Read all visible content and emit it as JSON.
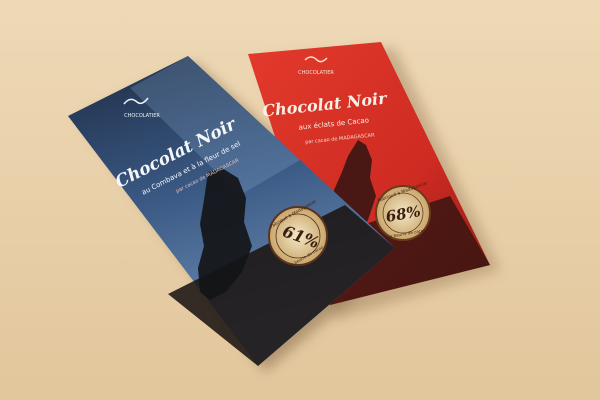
{
  "scene": {
    "background_color": "#e8cfa6",
    "shadow_color": "#a98d6a"
  },
  "bar_red": {
    "color": "#d93228",
    "brand": "CHOCOLATIER",
    "title": "Chocolat Noir",
    "subtitle": "aux éclats de Cacao",
    "origin": "par cacao de MADAGASCAR",
    "seal_top": "Fabriqué à Madagascar",
    "seal_percent": "68%",
    "seal_bottom": "pur beurre de cacao"
  },
  "bar_blue": {
    "color": "#2c4367",
    "brand": "CHOCOLATIER",
    "title": "Chocolat Noir",
    "subtitle": "au Combava et à la fleur de sel",
    "origin": "par cacao de MADAGASCAR",
    "seal_top": "Fabriqué à Madagascar",
    "seal_percent": "61%",
    "seal_bottom": "pur beurre de cacao"
  }
}
